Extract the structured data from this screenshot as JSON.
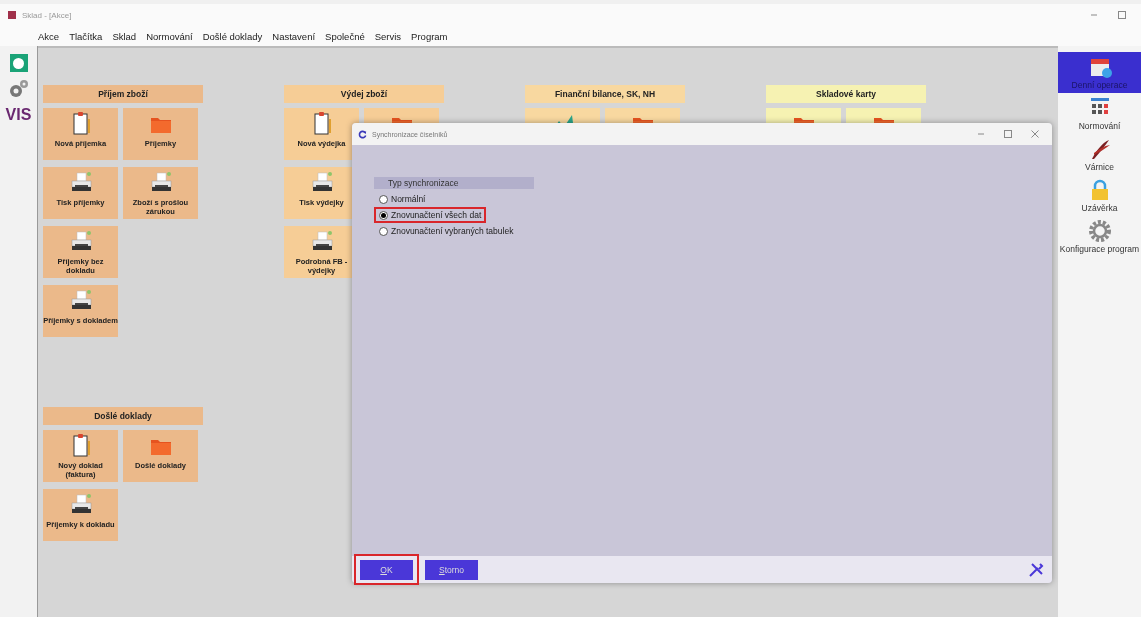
{
  "window": {
    "title": "Sklad - [Akce]"
  },
  "menu": [
    {
      "label": "Akce"
    },
    {
      "label": "Tlačítka"
    },
    {
      "label": "Sklad"
    },
    {
      "label": "Normování"
    },
    {
      "label": "Došlé doklady"
    },
    {
      "label": "Nastavení"
    },
    {
      "label": "Společné"
    },
    {
      "label": "Servis"
    },
    {
      "label": "Program"
    }
  ],
  "left_toolbar": {
    "logo_text": "VIS"
  },
  "columns": [
    [
      {
        "title": "Příjem zboží",
        "color": "#ebb98a",
        "tile_rows": [
          [
            {
              "kind": "clipboard",
              "label": "Nová příjemka"
            },
            {
              "kind": "folder",
              "label": "Příjemky"
            }
          ],
          [
            {
              "kind": "printer",
              "label": "Tisk příjemky"
            },
            {
              "kind": "printer",
              "label": "Zboží s prošlou zárukou"
            }
          ],
          [
            {
              "kind": "printer",
              "label": "Příjemky bez dokladu"
            }
          ],
          [
            {
              "kind": "printer",
              "label": "Příjemky s dokladem"
            }
          ]
        ]
      },
      {
        "title": "Došlé doklady",
        "color": "#ebb98a",
        "tile_rows": [
          [
            {
              "kind": "clipboard",
              "label": "Nový doklad (faktura)"
            },
            {
              "kind": "folder",
              "label": "Došlé doklady"
            }
          ],
          [
            {
              "kind": "printer",
              "label": "Příjemky k dokladu"
            }
          ]
        ]
      }
    ],
    [
      {
        "title": "Výdej zboží",
        "color": "#f6cd96",
        "tile_rows": [
          [
            {
              "kind": "clipboard",
              "label": "Nová výdejka"
            },
            {
              "kind": "folder"
            }
          ],
          [
            {
              "kind": "printer",
              "label": "Tisk výdejky"
            }
          ],
          [
            {
              "kind": "printer",
              "label": "Podrobná FB - výdejky"
            }
          ]
        ]
      }
    ],
    [
      {
        "title": "Finanční bilance, SK, NH",
        "color": "#f8d8a0",
        "tile_rows": [
          [
            {
              "kind": "chart"
            },
            {
              "kind": "folder"
            }
          ]
        ]
      }
    ],
    [
      {
        "title": "Skladové karty",
        "color": "#f6f2b2",
        "tile_rows": [
          [
            {
              "kind": "folder"
            },
            {
              "kind": "folder"
            }
          ]
        ]
      }
    ]
  ],
  "right_panel": [
    {
      "kind": "calendar",
      "label": "Denní operace",
      "selected": true
    },
    {
      "kind": "calculator",
      "label": "Normování",
      "selected": false
    },
    {
      "kind": "feather",
      "label": "Várnice",
      "selected": false
    },
    {
      "kind": "lock",
      "label": "Uzávěrka",
      "selected": false
    },
    {
      "kind": "gear",
      "label": "Konfigurace program",
      "selected": false
    }
  ],
  "dialog": {
    "title": "Synchronizace číselníků",
    "group_label": "Typ synchronizace",
    "options": [
      {
        "label": "Normální",
        "selected": false,
        "highlighted": false
      },
      {
        "label": "Znovunačtení všech dat",
        "selected": true,
        "highlighted": true
      },
      {
        "label": "Znovunačtení vybraných tabulek",
        "selected": false,
        "highlighted": false
      }
    ],
    "buttons": [
      {
        "label": "OK",
        "highlighted": true
      },
      {
        "label": "Storno",
        "highlighted": false
      }
    ]
  }
}
